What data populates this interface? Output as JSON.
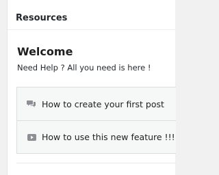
{
  "panel": {
    "title": "Resources"
  },
  "welcome": {
    "title": "Welcome",
    "subtitle": "Need Help ? All you need is here !"
  },
  "links": [
    {
      "icon": "comments-icon",
      "label": "How to create your first post"
    },
    {
      "icon": "video-play-icon",
      "label": "How to use this new feature !!!"
    }
  ],
  "colors": {
    "icon": "#8c8f94",
    "link_bg": "#f6f7f7",
    "border": "#dcdcde"
  }
}
